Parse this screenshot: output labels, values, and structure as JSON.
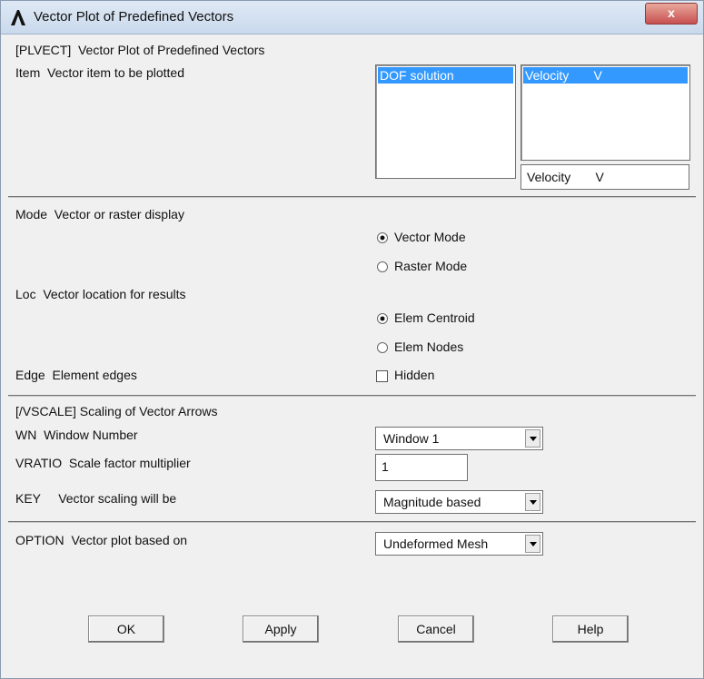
{
  "window": {
    "title": "Vector Plot of Predefined Vectors",
    "close_label": "x"
  },
  "plvect": {
    "header": "[PLVECT]  Vector Plot of Predefined Vectors",
    "item_label": "Item  Vector item to be plotted",
    "left_list": [
      "DOF solution"
    ],
    "right_list": [
      "Velocity       V"
    ],
    "selection_field": "Velocity       V"
  },
  "mode": {
    "label": "Mode  Vector or raster display",
    "options": [
      "Vector Mode",
      "Raster Mode"
    ],
    "selected": "Vector Mode"
  },
  "loc": {
    "label": "Loc  Vector location for results",
    "options": [
      "Elem Centroid",
      "Elem Nodes"
    ],
    "selected": "Elem Centroid"
  },
  "edge": {
    "label": "Edge  Element edges",
    "checkbox_label": "Hidden",
    "checked": false
  },
  "vscale": {
    "header": "[/VSCALE] Scaling of Vector Arrows",
    "wn_label": "WN  Window Number",
    "wn_value": "Window 1",
    "vratio_label": "VRATIO  Scale factor multiplier",
    "vratio_value": "1",
    "key_label": "KEY     Vector scaling will be",
    "key_value": "Magnitude based"
  },
  "option": {
    "label": "OPTION  Vector plot based on",
    "value": "Undeformed Mesh"
  },
  "buttons": {
    "ok": "OK",
    "apply": "Apply",
    "cancel": "Cancel",
    "help": "Help"
  }
}
